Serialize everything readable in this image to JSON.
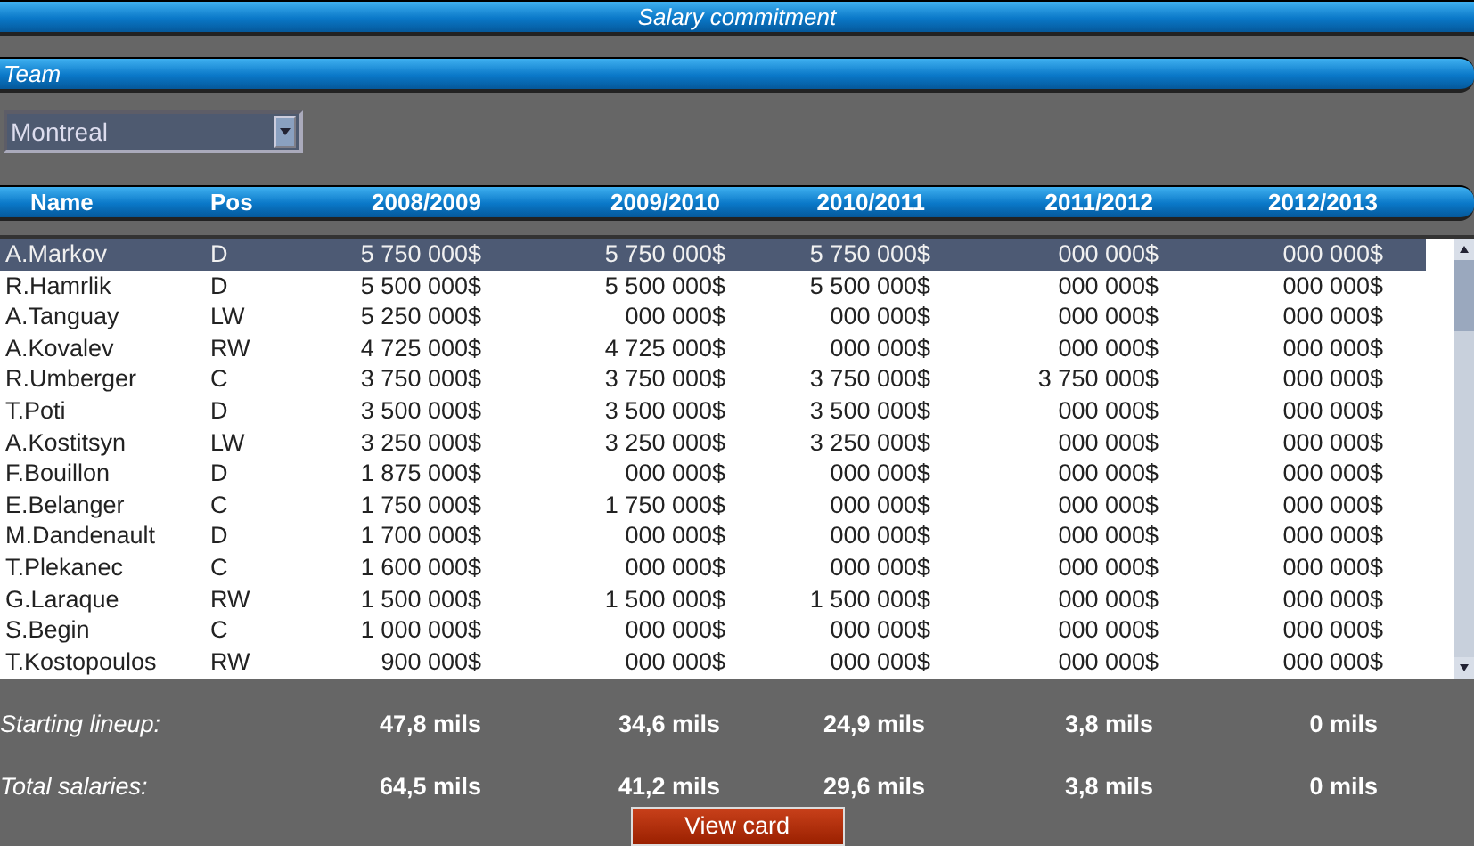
{
  "window": {
    "title": "Salary commitment"
  },
  "team_section": {
    "title": "Team",
    "dropdown": {
      "value": "Montreal"
    }
  },
  "table": {
    "columns": [
      "Name",
      "Pos",
      "2008/2009",
      "2009/2010",
      "2010/2011",
      "2011/2012",
      "2012/2013"
    ],
    "rows": [
      {
        "selected": true,
        "cells": [
          "A.Markov",
          "D",
          "5 750 000$",
          "5 750 000$",
          "5 750 000$",
          "000 000$",
          "000 000$"
        ]
      },
      {
        "selected": false,
        "cells": [
          "R.Hamrlik",
          "D",
          "5 500 000$",
          "5 500 000$",
          "5 500 000$",
          "000 000$",
          "000 000$"
        ]
      },
      {
        "selected": false,
        "cells": [
          "A.Tanguay",
          "LW",
          "5 250 000$",
          "000 000$",
          "000 000$",
          "000 000$",
          "000 000$"
        ]
      },
      {
        "selected": false,
        "cells": [
          "A.Kovalev",
          "RW",
          "4 725 000$",
          "4 725 000$",
          "000 000$",
          "000 000$",
          "000 000$"
        ]
      },
      {
        "selected": false,
        "cells": [
          "R.Umberger",
          "C",
          "3 750 000$",
          "3 750 000$",
          "3 750 000$",
          "3 750 000$",
          "000 000$"
        ]
      },
      {
        "selected": false,
        "cells": [
          "T.Poti",
          "D",
          "3 500 000$",
          "3 500 000$",
          "3 500 000$",
          "000 000$",
          "000 000$"
        ]
      },
      {
        "selected": false,
        "cells": [
          "A.Kostitsyn",
          "LW",
          "3 250 000$",
          "3 250 000$",
          "3 250 000$",
          "000 000$",
          "000 000$"
        ]
      },
      {
        "selected": false,
        "cells": [
          "F.Bouillon",
          "D",
          "1 875 000$",
          "000 000$",
          "000 000$",
          "000 000$",
          "000 000$"
        ]
      },
      {
        "selected": false,
        "cells": [
          "E.Belanger",
          "C",
          "1 750 000$",
          "1 750 000$",
          "000 000$",
          "000 000$",
          "000 000$"
        ]
      },
      {
        "selected": false,
        "cells": [
          "M.Dandenault",
          "D",
          "1 700 000$",
          "000 000$",
          "000 000$",
          "000 000$",
          "000 000$"
        ]
      },
      {
        "selected": false,
        "cells": [
          "T.Plekanec",
          "C",
          "1 600 000$",
          "000 000$",
          "000 000$",
          "000 000$",
          "000 000$"
        ]
      },
      {
        "selected": false,
        "cells": [
          "G.Laraque",
          "RW",
          "1 500 000$",
          "1 500 000$",
          "1 500 000$",
          "000 000$",
          "000 000$"
        ]
      },
      {
        "selected": false,
        "cells": [
          "S.Begin",
          "C",
          "1 000 000$",
          "000 000$",
          "000 000$",
          "000 000$",
          "000 000$"
        ]
      },
      {
        "selected": false,
        "cells": [
          "T.Kostopoulos",
          "RW",
          "900 000$",
          "000 000$",
          "000 000$",
          "000 000$",
          "000 000$"
        ]
      }
    ]
  },
  "totals": [
    {
      "label": "Starting lineup:",
      "values": [
        "47,8 mils",
        "34,6 mils",
        "24,9 mils",
        "3,8 mils",
        "0 mils"
      ]
    },
    {
      "label": "Total salaries:",
      "values": [
        "64,5 mils",
        "41,2 mils",
        "29,6 mils",
        "3,8 mils",
        "0 mils"
      ]
    }
  ],
  "buttons": [
    "View card"
  ]
}
